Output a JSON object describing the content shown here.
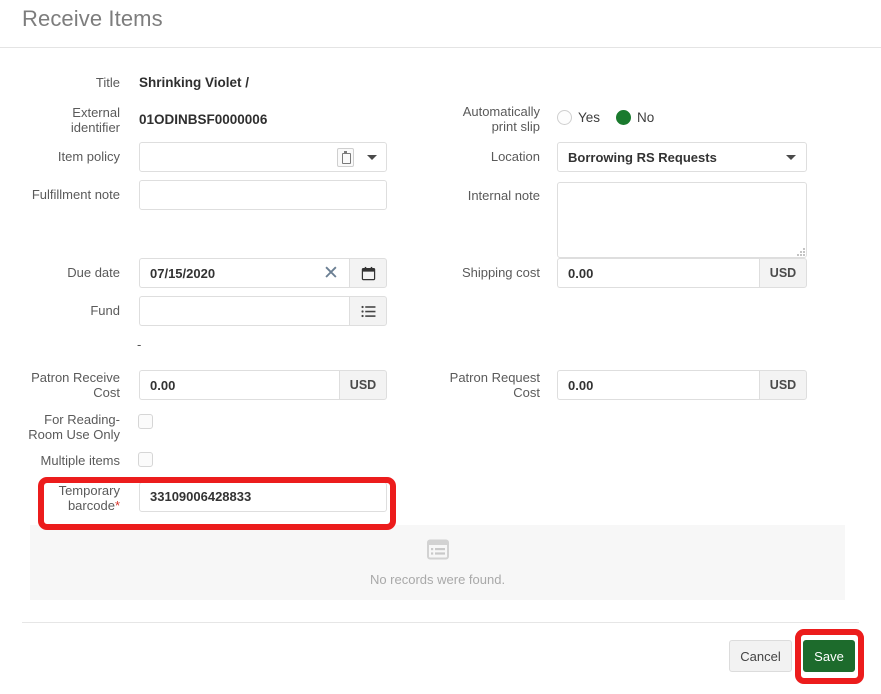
{
  "header": {
    "title": "Receive Items"
  },
  "left_column": {
    "title": {
      "label": "Title",
      "value": "Shrinking Violet /"
    },
    "external_identifier": {
      "label": "External identifier",
      "label_line1": "External",
      "label_line2": "identifier",
      "value": "01ODINBSF0000006"
    },
    "item_policy": {
      "label": "Item policy",
      "value": "",
      "picker_icon": "picker-icon",
      "caret_icon": "chevron-down-icon"
    },
    "fulfillment_note": {
      "label": "Fulfillment note",
      "value": ""
    },
    "due_date": {
      "label": "Due date",
      "value": "07/15/2020",
      "clear_icon": "close-icon",
      "calendar_icon": "calendar-icon"
    },
    "fund": {
      "label": "Fund",
      "value": "",
      "list_icon": "list-icon",
      "separator": "-"
    },
    "patron_receive_cost": {
      "label": "Patron Receive Cost",
      "label_line1": "Patron Receive",
      "label_line2": "Cost",
      "value": "0.00",
      "currency": "USD"
    },
    "reading_room_only": {
      "label": "For Reading-Room Use Only",
      "label_line1": "For Reading-",
      "label_line2": "Room Use Only",
      "checked": false
    },
    "multiple_items": {
      "label": "Multiple items",
      "checked": false
    },
    "temporary_barcode": {
      "label": "Temporary barcode",
      "label_line1": "Temporary",
      "label_line2": "barcode",
      "required_marker": "*",
      "value": "33109006428833"
    }
  },
  "right_column": {
    "auto_print_slip": {
      "label": "Automatically print slip",
      "label_line1": "Automatically",
      "label_line2": "print slip",
      "options": [
        "Yes",
        "No"
      ],
      "selected": "No"
    },
    "location": {
      "label": "Location",
      "value": "Borrowing RS Requests",
      "caret_icon": "chevron-down-icon"
    },
    "internal_note": {
      "label": "Internal note",
      "value": ""
    },
    "shipping_cost": {
      "label": "Shipping cost",
      "value": "0.00",
      "currency": "USD"
    },
    "patron_request_cost": {
      "label": "Patron Request Cost",
      "label_line1": "Patron Request",
      "label_line2": "Cost",
      "value": "0.00",
      "currency": "USD"
    }
  },
  "empty_state": {
    "icon": "list-table-icon",
    "message": "No records were found."
  },
  "footer": {
    "cancel_label": "Cancel",
    "save_label": "Save"
  },
  "colors": {
    "save_green": "#1d6b2c",
    "radio_green": "#1a7a2e",
    "annotation_red": "#ec1c1c",
    "required_red": "#d8342a",
    "title_gray": "#7d7d7d"
  },
  "annotations": {
    "highlight_barcode": "red-highlight-temporary-barcode",
    "highlight_save": "red-highlight-save-button"
  }
}
